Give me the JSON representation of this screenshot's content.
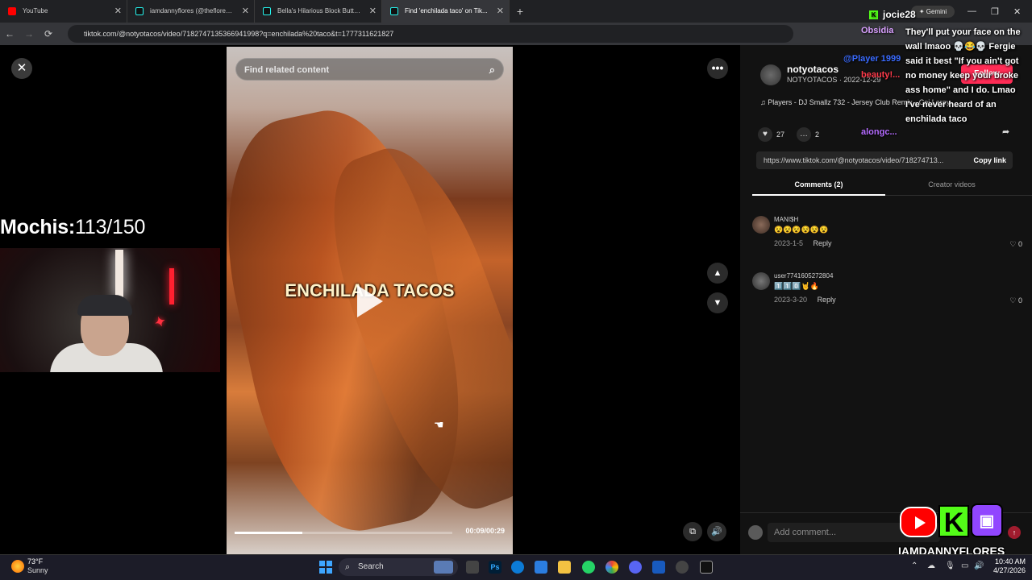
{
  "browser": {
    "tabs": [
      {
        "title": "YouTube",
        "active": false,
        "icon": "youtube-icon"
      },
      {
        "title": "iamdannyflores (@thefloresrep...",
        "active": false,
        "icon": "tiktok-icon"
      },
      {
        "title": "Bella's Hilarious Block Button M...",
        "active": false,
        "icon": "tiktok-icon"
      },
      {
        "title": "Find 'enchilada taco' on Tik...",
        "active": true,
        "icon": "tiktok-icon"
      }
    ],
    "new_tab": "+",
    "url": "tiktok.com/@notyotacos/video/7182747135366941998?q=enchilada%20taco&t=1777311621827"
  },
  "video": {
    "search_placeholder": "Find related content",
    "overlay_text": "ENCHILADA TACOS",
    "time": "00:09/00:29",
    "progress": 0.31
  },
  "stream_overlay": {
    "mochis_label": "Mochis:",
    "mochis_count": "113/150",
    "brand": "IAMDANNYFLORES"
  },
  "panel": {
    "username": "notyotacos",
    "handle_date": "NOTYOTACOS · 2022-12-29",
    "follow": "Follow",
    "music": "♫  Players - DJ Smallz 732 - Jersey Club Remix - Coi Leray",
    "likes": "27",
    "comments_count": "2",
    "link": "https://www.tiktok.com/@notyotacos/video/718274713...",
    "copy_link": "Copy link",
    "tab_comments": "Comments (2)",
    "tab_creator": "Creator videos",
    "comments": [
      {
        "user": "MANI$H",
        "text": "😵😵😵😵😵😵",
        "date": "2023-1-5",
        "reply": "Reply",
        "likes": "0"
      },
      {
        "user": "user7741605272804",
        "text": "1️⃣1️⃣0️⃣🤘🔥",
        "date": "2023-3-20",
        "reply": "Reply",
        "likes": "0"
      }
    ],
    "add_comment": "Add comment..."
  },
  "chat": {
    "top_user": "jocie28",
    "gemini": "Gemini",
    "messages": "They'll put your face on the wall lmaoo 💀😂💀 Fergie said it best \"If you ain't got no money keep your broke ass home\" and I do. Lmao I've never heard of an enchilada taco",
    "names": [
      {
        "name": "Obsidia",
        "color": "#d9a0ff"
      },
      {
        "name": "@Player 1999",
        "color": "#3a6bff"
      },
      {
        "name": "beauty!...",
        "color": "#ff3a4a"
      },
      {
        "name": "alongc...",
        "color": "#b46bff"
      }
    ]
  },
  "taskbar": {
    "temp": "73°F",
    "condition": "Sunny",
    "search": "Search",
    "time": "10:40 AM",
    "date": "4/27/2026"
  }
}
